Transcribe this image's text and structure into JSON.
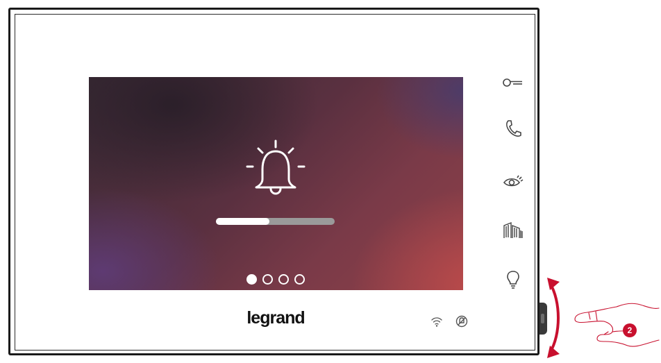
{
  "brand": {
    "logo_text": "legrand"
  },
  "screen": {
    "icon": "bell-ringing-icon",
    "progress": 0.45,
    "pagination": {
      "total": 4,
      "active": 1
    }
  },
  "side_buttons": [
    {
      "name": "door-key-icon"
    },
    {
      "name": "phone-handset-icon"
    },
    {
      "name": "eye-icon"
    },
    {
      "name": "gate-icon"
    },
    {
      "name": "light-bulb-icon"
    }
  ],
  "status": {
    "wifi": "wifi-icon",
    "mute": "ringtone-off-icon"
  },
  "annotation": {
    "step_number": "2",
    "accent_color": "#c8102e"
  }
}
